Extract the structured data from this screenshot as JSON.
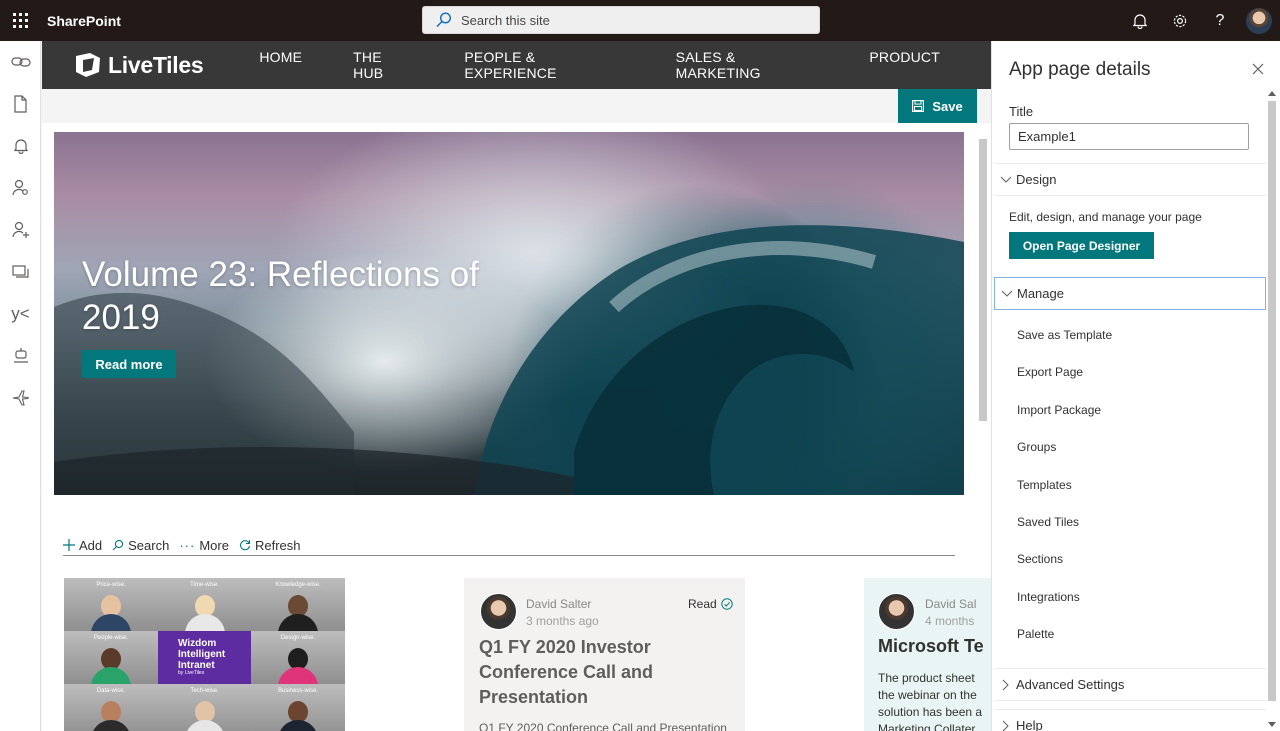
{
  "suite": {
    "app_name": "SharePoint",
    "search_placeholder": "Search this site"
  },
  "site": {
    "logo_text": "LiveTiles",
    "nav": [
      "HOME",
      "THE HUB",
      "PEOPLE & EXPERIENCE",
      "SALES & MARKETING",
      "PRODUCT"
    ]
  },
  "toolbar": {
    "save": "Save",
    "add": "Add",
    "search": "Search",
    "more": "More",
    "refresh": "Refresh"
  },
  "hero": {
    "title": "Volume 23: Reflections of 2019",
    "button": "Read more"
  },
  "tiles": {
    "labels": [
      "Price-wise.",
      "Time-wise.",
      "Knowledge-wise.",
      "People-wise.",
      "",
      "Design-wise.",
      "Data-wise.",
      "Tech-wise.",
      "Business-wise."
    ],
    "center_title": "Wizdom Intelligent Intranet",
    "center_by": "by LiveTiles"
  },
  "news": [
    {
      "author": "David Salter",
      "ago": "3 months ago",
      "status": "Read",
      "title": "Q1 FY 2020 Investor Conference Call and Presentation",
      "description": "Q1 FY 2020 Conference Call and Presentation"
    },
    {
      "author": "David Sal",
      "ago": "4 months",
      "title": "Microsoft Te",
      "description_lines": [
        "The product sheet",
        "the webinar on the",
        "solution has been a",
        "Marketing Collater"
      ]
    }
  ],
  "panel": {
    "title": "App page details",
    "title_label": "Title",
    "title_value": "Example1",
    "design_header": "Design",
    "design_desc": "Edit, design, and manage your page",
    "designer_button": "Open Page Designer",
    "manage_header": "Manage",
    "manage_items": [
      "Save as Template",
      "Export Page",
      "Import Package",
      "Groups",
      "Templates",
      "Saved Tiles",
      "Sections",
      "Integrations",
      "Palette"
    ],
    "advanced_header": "Advanced Settings",
    "help_header": "Help"
  },
  "colors": {
    "accent": "#03787c",
    "suitebar": "#231a18",
    "siteheader": "#383838"
  }
}
